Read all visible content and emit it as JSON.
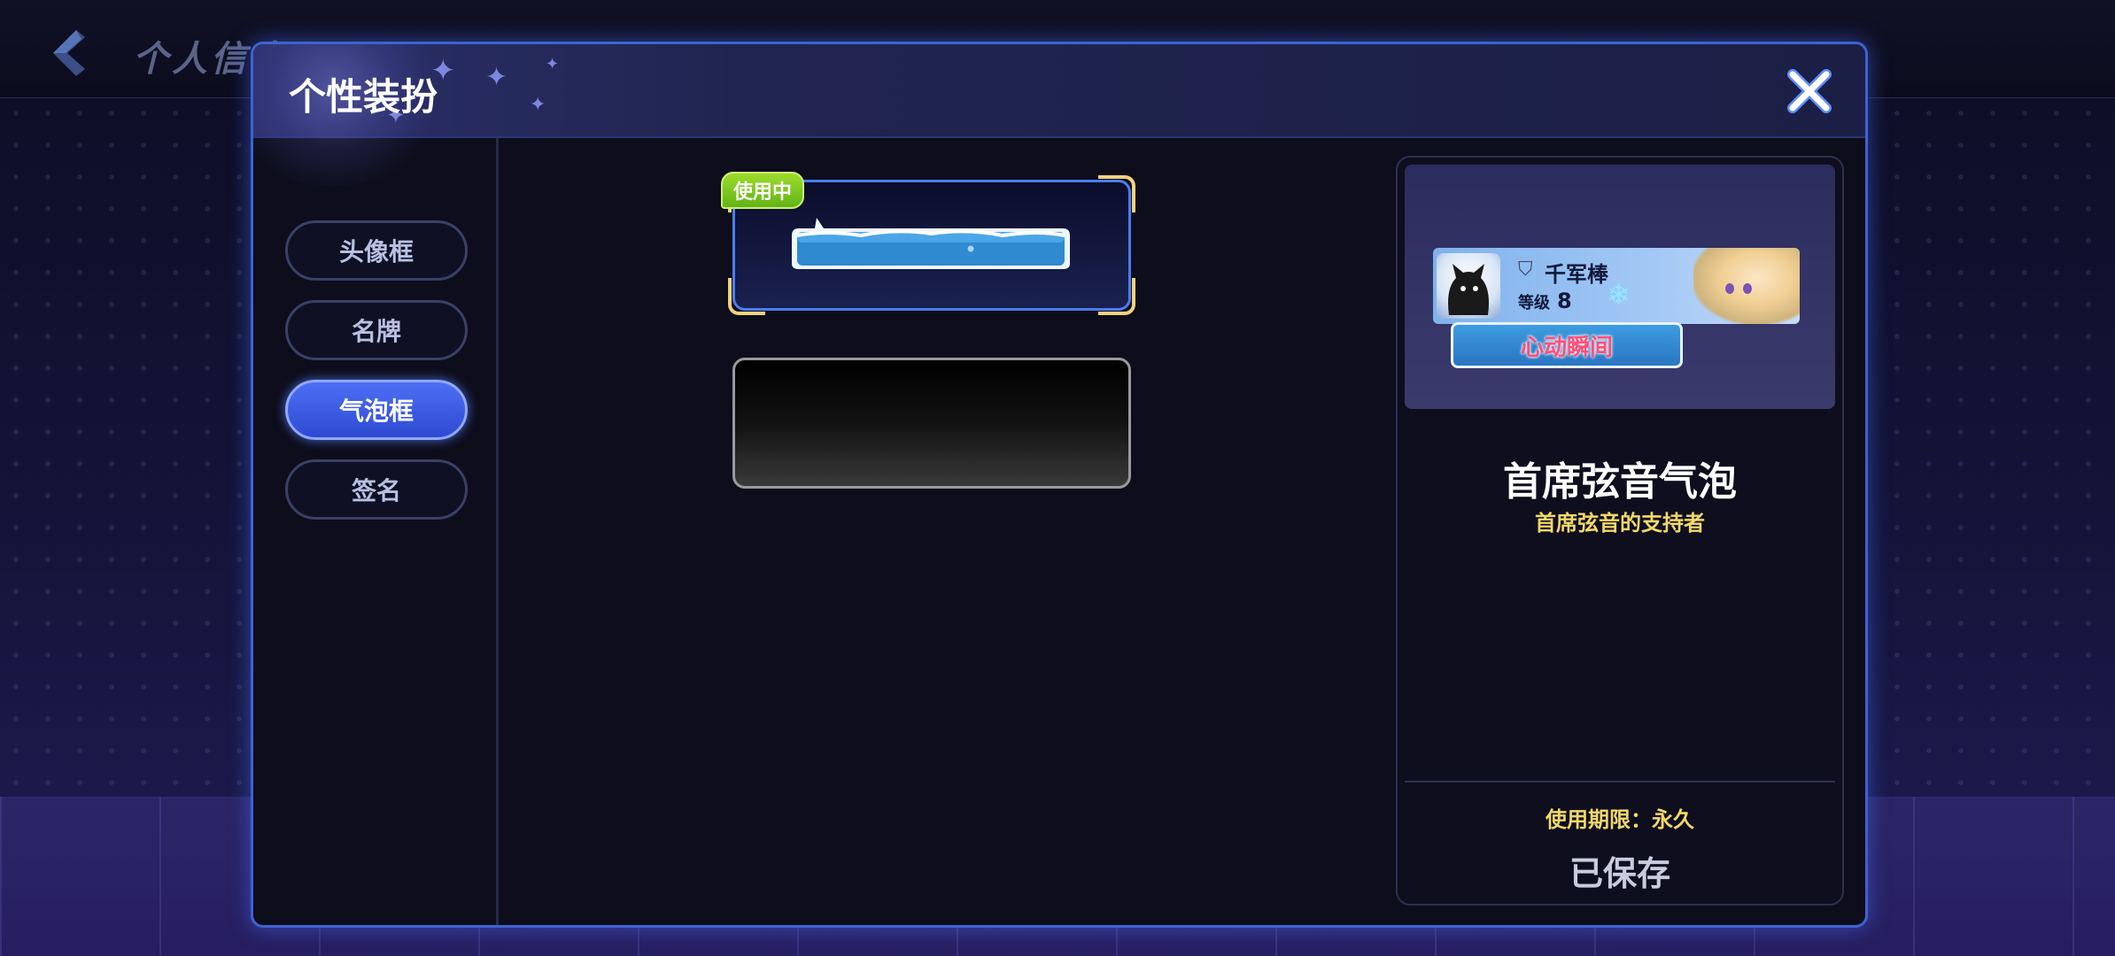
{
  "background": {
    "back_title": "个人信息"
  },
  "modal": {
    "title": "个性装扮",
    "close_icon": "close-icon"
  },
  "sidebar": {
    "items": [
      {
        "label": "头像框",
        "active": false
      },
      {
        "label": "名牌",
        "active": false
      },
      {
        "label": "气泡框",
        "active": true
      },
      {
        "label": "签名",
        "active": false
      }
    ]
  },
  "bubbles": {
    "in_use_label": "使用中"
  },
  "preview": {
    "nameplate": {
      "name": "千军棒",
      "level_label": "等级",
      "level_value": "8"
    },
    "sample_bubble_text": "心动瞬间",
    "item_title": "首席弦音气泡",
    "item_desc": "首席弦音的支持者",
    "expiry": "使用期限：永久",
    "saved_label": "已保存"
  },
  "colors": {
    "accent_blue": "#4b7cf0",
    "active_tab": "#3a58e0",
    "gold_text": "#f2d86a",
    "in_use_green": "#7cc520"
  }
}
